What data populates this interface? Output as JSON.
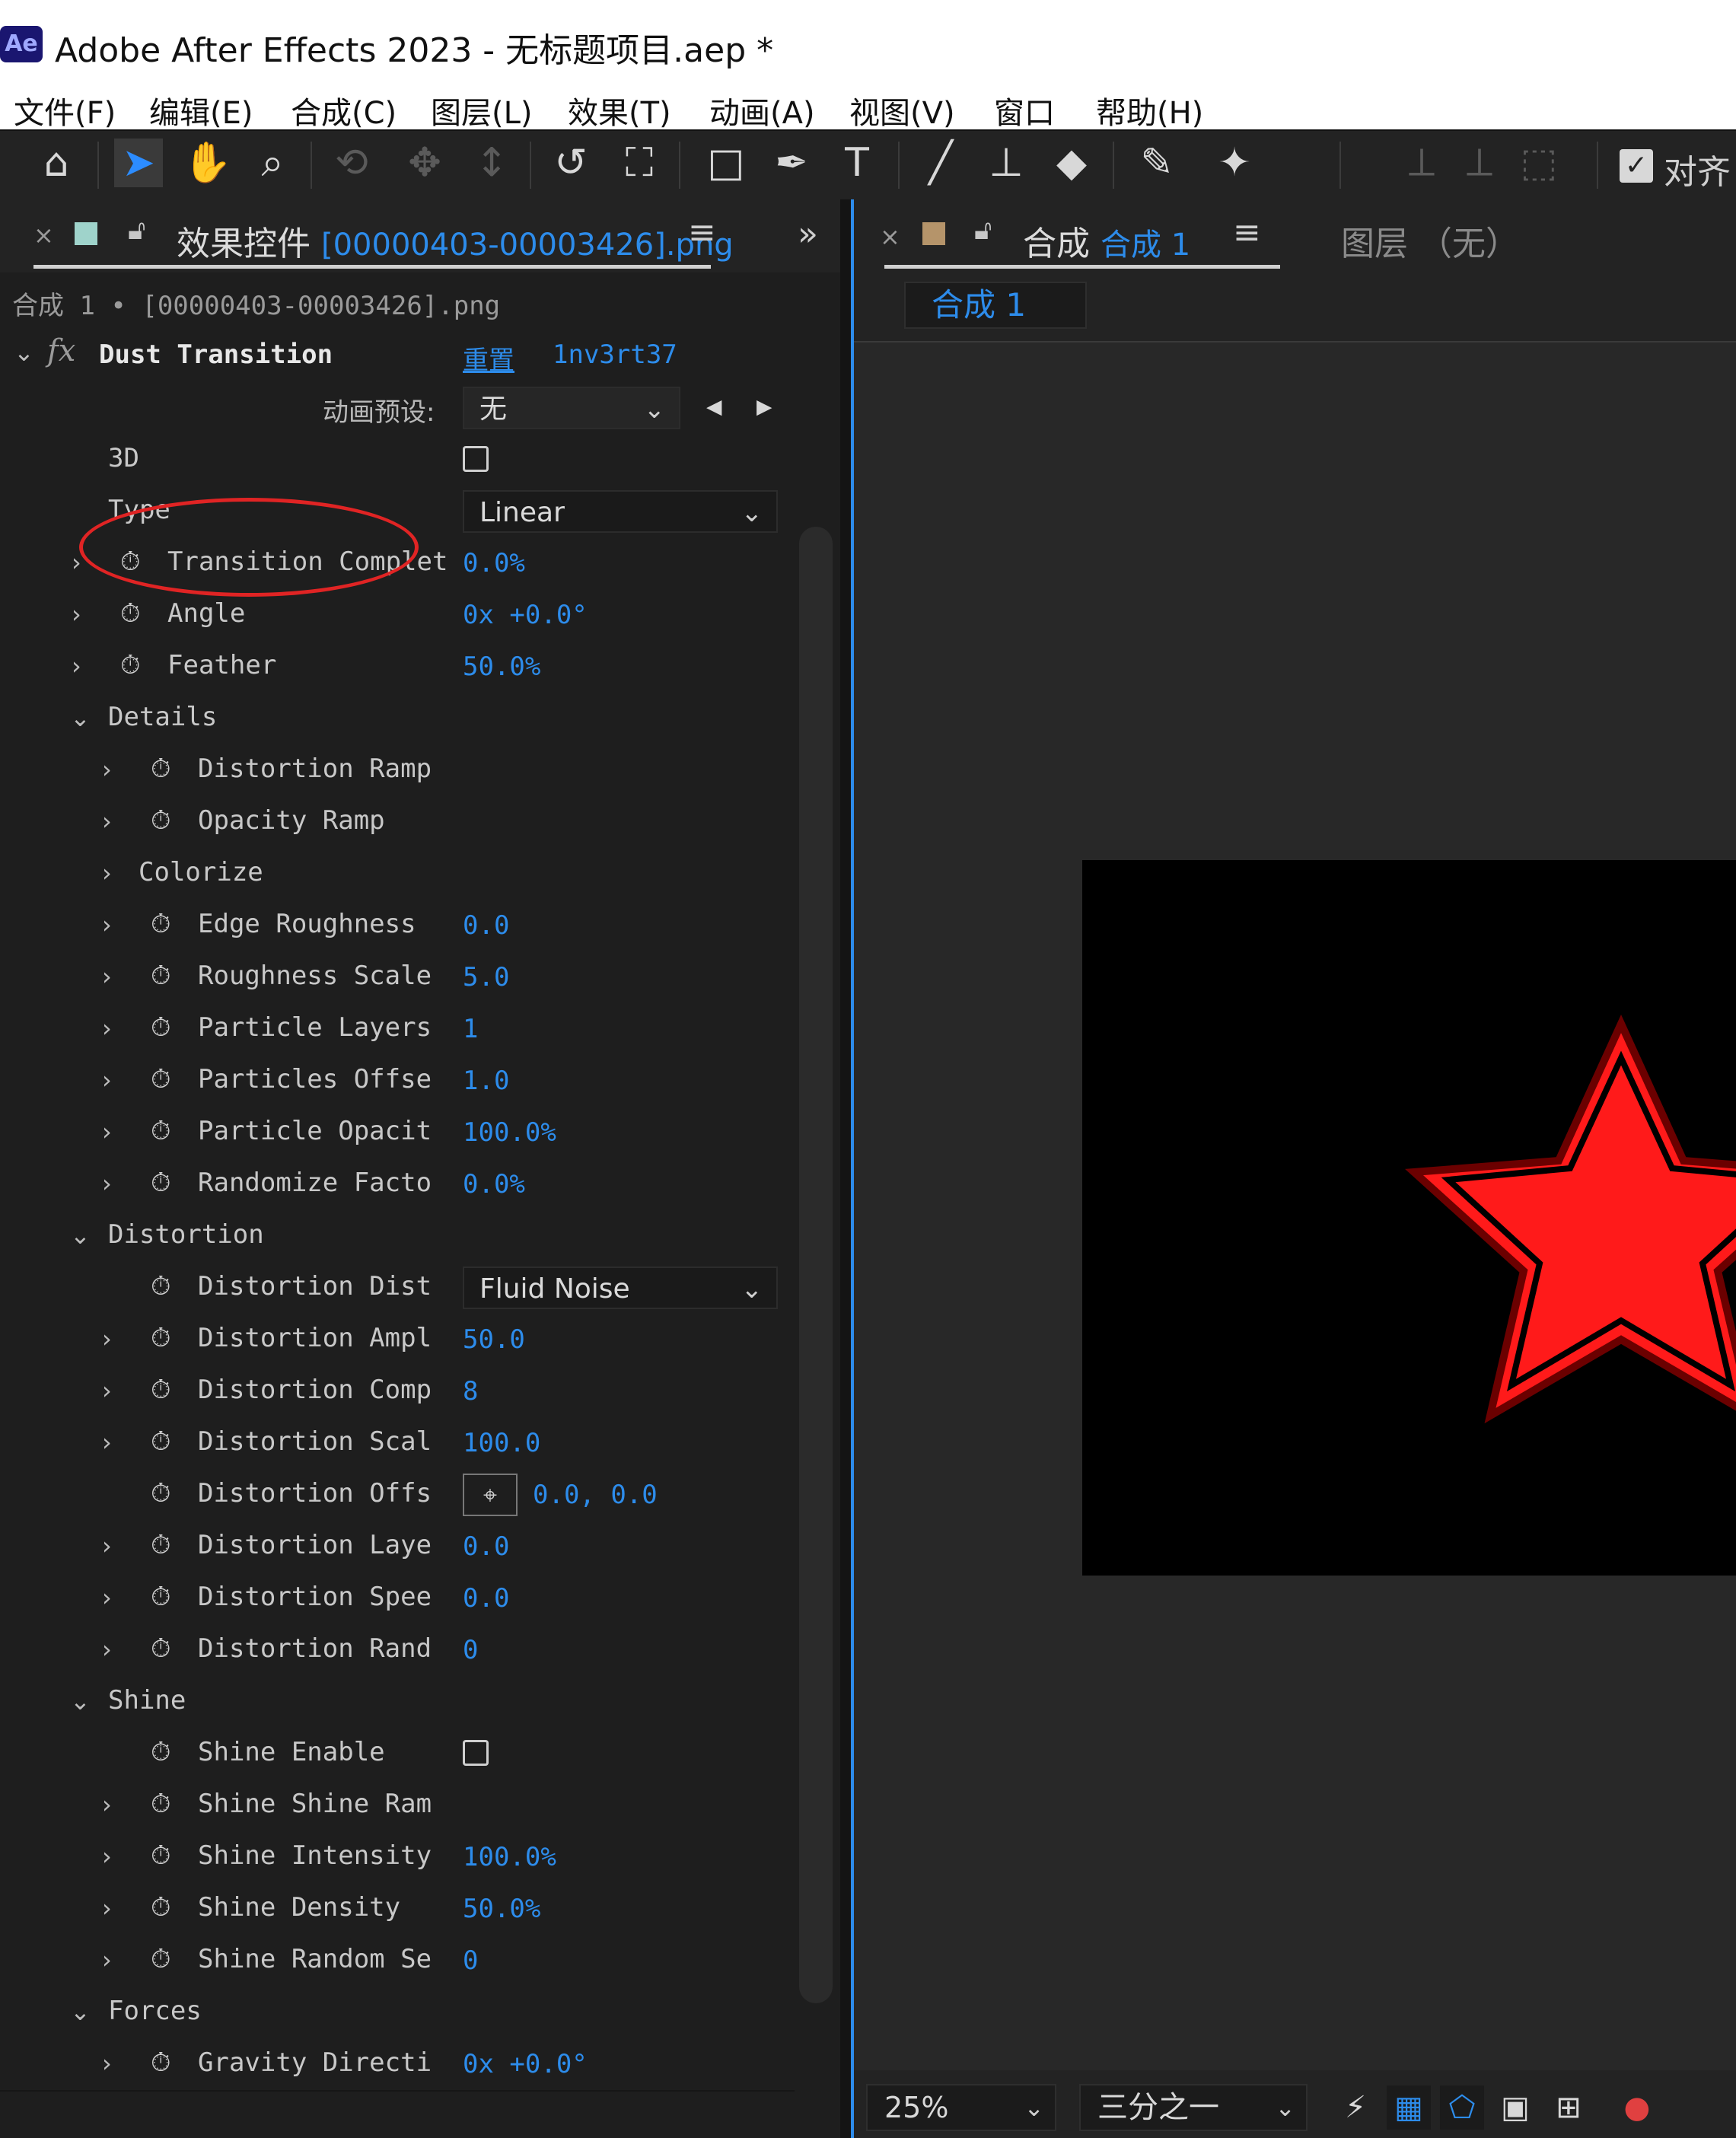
{
  "window": {
    "app_badge": "Ae",
    "title": "Adobe After Effects 2023 - 无标题项目.aep *"
  },
  "menubar": [
    "文件(F)",
    "编辑(E)",
    "合成(C)",
    "图层(L)",
    "效果(T)",
    "动画(A)",
    "视图(V)",
    "窗口",
    "帮助(H)"
  ],
  "toolbar": {
    "align_label": "对齐"
  },
  "effects_panel": {
    "close_glyph": "×",
    "tab_prefix": "效果控件",
    "tab_file": "[00000403-00003426].png",
    "menu_glyph": "≡",
    "overflow_glyph": "»",
    "breadcrumb": "合成 1 • [00000403-00003426].png",
    "effect": {
      "fx_glyph": "fx",
      "name": "Dust Transition",
      "reset_label": "重置",
      "author": "1nv3rt37",
      "preset_label": "动画预设:",
      "preset_value": "无"
    },
    "rows": [
      {
        "label": "3D",
        "type": "checkbox"
      },
      {
        "label": "Type",
        "type": "dropdown",
        "value": "Linear"
      },
      {
        "label": "Transition Complet",
        "value": "0.0%"
      },
      {
        "label": "Angle",
        "value": "0x +0.0°"
      },
      {
        "label": "Feather",
        "value": "50.0%"
      },
      {
        "label": "Details",
        "type": "group"
      },
      {
        "label": "Distortion Ramp"
      },
      {
        "label": "Opacity Ramp"
      },
      {
        "label": "Colorize",
        "type": "subgroup"
      },
      {
        "label": "Edge Roughness",
        "value": "0.0"
      },
      {
        "label": "Roughness Scale",
        "value": "5.0"
      },
      {
        "label": "Particle Layers",
        "value": "1"
      },
      {
        "label": "Particles Offse",
        "value": "1.0"
      },
      {
        "label": "Particle Opacit",
        "value": "100.0%"
      },
      {
        "label": "Randomize Facto",
        "value": "0.0%"
      },
      {
        "label": "Distortion",
        "type": "group"
      },
      {
        "label": "Distortion Dist",
        "type": "dropdown",
        "value": "Fluid Noise"
      },
      {
        "label": "Distortion Ampl",
        "value": "50.0"
      },
      {
        "label": "Distortion Comp",
        "value": "8"
      },
      {
        "label": "Distortion Scal",
        "value": "100.0"
      },
      {
        "label": "Distortion Offs",
        "type": "point",
        "value": "0.0, 0.0"
      },
      {
        "label": "Distortion Laye",
        "value": "0.0"
      },
      {
        "label": "Distortion Spee",
        "value": "0.0"
      },
      {
        "label": "Distortion Rand",
        "value": "0"
      },
      {
        "label": "Shine",
        "type": "group"
      },
      {
        "label": "Shine Enable",
        "type": "checkbox"
      },
      {
        "label": "Shine Shine Ram"
      },
      {
        "label": "Shine Intensity",
        "value": "100.0%"
      },
      {
        "label": "Shine Density",
        "value": "50.0%"
      },
      {
        "label": "Shine Random Se",
        "value": "0"
      },
      {
        "label": "Forces",
        "type": "group"
      },
      {
        "label": "Gravity Directi",
        "value": "0x +0.0°"
      }
    ]
  },
  "composition_panel": {
    "close_glyph": "×",
    "tab_prefix": "合成",
    "tab_name": "合成 1",
    "menu_glyph": "≡",
    "layer_tab": "图层 （无）",
    "subtab": "合成 1",
    "zoom": "25%",
    "resolution": "三分之一"
  },
  "colors": {
    "accent": "#2d8ceb",
    "panel_bg": "#1e1e1e",
    "star_red": "#ff1a1a",
    "annotation_red": "#e02424"
  }
}
